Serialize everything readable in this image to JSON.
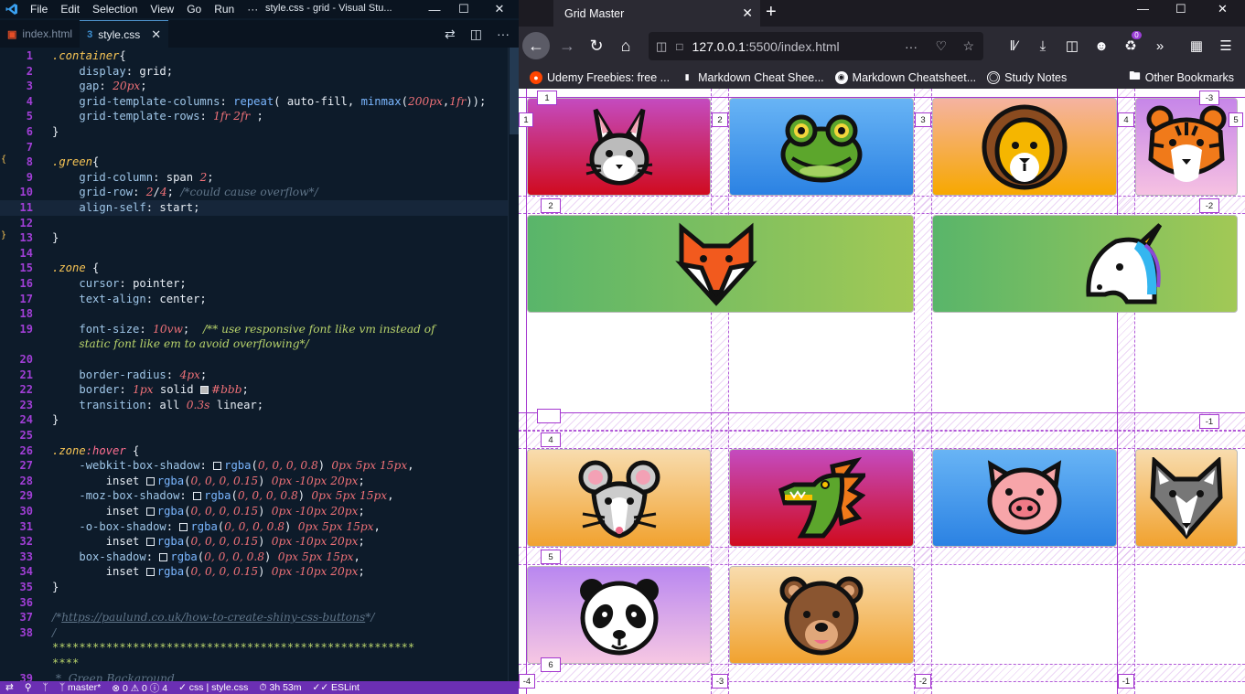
{
  "vscode": {
    "menus": [
      "File",
      "Edit",
      "Selection",
      "View",
      "Go",
      "Run",
      "···"
    ],
    "title": "style.css - grid - Visual Stu...",
    "tabs": [
      {
        "label": "index.html",
        "icon": "html-file-icon",
        "active": false
      },
      {
        "label": "style.css",
        "icon": "css-file-icon",
        "active": true
      }
    ],
    "status": {
      "branch": "master*",
      "errors": "0",
      "warnings": "0",
      "infos": "4",
      "language": "css | style.css",
      "time": "3h 53m",
      "linter": "ESLint"
    }
  },
  "code": [
    {
      "n": "1",
      "html": "<span class='t-sel'>.container</span><span class='t-plain'>{</span>"
    },
    {
      "n": "2",
      "html": "    <span class='t-prop'>display</span><span class='t-plain'>: grid;</span>"
    },
    {
      "n": "3",
      "html": "    <span class='t-prop'>gap</span><span class='t-plain'>: </span><span class='t-num'>20px</span><span class='t-plain'>;</span>"
    },
    {
      "n": "4",
      "html": "    <span class='t-prop'>grid-template-columns</span><span class='t-plain'>: </span><span class='t-fn'>repeat</span><span class='t-plain'>( auto-fill, </span><span class='t-fn'>minmax</span><span class='t-plain'>(</span><span class='t-num'>200px</span><span class='t-plain'>,</span><span class='t-num'>1fr</span><span class='t-plain'>));</span>"
    },
    {
      "n": "5",
      "html": "    <span class='t-prop'>grid-template-rows</span><span class='t-plain'>: </span><span class='t-num'>1fr 2fr</span><span class='t-plain'> ;</span>"
    },
    {
      "n": "6",
      "html": "<span class='t-plain'>}</span>"
    },
    {
      "n": "7",
      "html": ""
    },
    {
      "n": "8",
      "html": "<span class='t-sel'>.green</span><span class='t-plain'>{</span>"
    },
    {
      "n": "9",
      "html": "    <span class='t-prop'>grid-column</span><span class='t-plain'>: span </span><span class='t-num'>2</span><span class='t-plain'>;</span>"
    },
    {
      "n": "10",
      "html": "    <span class='t-prop'>grid-row</span><span class='t-plain'>: </span><span class='t-num'>2</span><span class='t-plain'>/</span><span class='t-num'>4</span><span class='t-plain'>; </span><span class='t-comment'>/*could cause overflow*/</span>"
    },
    {
      "n": "11",
      "html": "    <span class='t-prop'>align-self</span><span class='t-plain'>: start;</span>",
      "hl": true
    },
    {
      "n": "12",
      "html": ""
    },
    {
      "n": "13",
      "html": "<span class='t-plain'>}</span>"
    },
    {
      "n": "14",
      "html": ""
    },
    {
      "n": "15",
      "html": "<span class='t-sel'>.zone</span><span class='t-plain'> {</span>"
    },
    {
      "n": "16",
      "html": "    <span class='t-prop'>cursor</span><span class='t-plain'>: pointer;</span>"
    },
    {
      "n": "17",
      "html": "    <span class='t-prop'>text-align</span><span class='t-plain'>: center;</span>"
    },
    {
      "n": "18",
      "html": ""
    },
    {
      "n": "19",
      "html": "    <span class='t-prop'>font-size</span><span class='t-plain'>: </span><span class='t-num'>10vw</span><span class='t-plain'>;  </span><span class='t-comment2'>/** use responsive font like vm instead of</span>"
    },
    {
      "n": "",
      "html": "    <span class='t-comment2'>static font like em to avoid overflowing*/</span>"
    },
    {
      "n": "20",
      "html": ""
    },
    {
      "n": "21",
      "html": "    <span class='t-prop'>border-radius</span><span class='t-plain'>: </span><span class='t-num'>4px</span><span class='t-plain'>;</span>"
    },
    {
      "n": "22",
      "html": "    <span class='t-prop'>border</span><span class='t-plain'>: </span><span class='t-num'>1px</span><span class='t-plain'> solid </span><span class='swatch grey'></span><span class='t-num'>#bbb</span><span class='t-plain'>;</span>"
    },
    {
      "n": "23",
      "html": "    <span class='t-prop'>transition</span><span class='t-plain'>: all </span><span class='t-num'>0.3s</span><span class='t-plain'> linear;</span>"
    },
    {
      "n": "24",
      "html": "<span class='t-plain'>}</span>"
    },
    {
      "n": "25",
      "html": ""
    },
    {
      "n": "26",
      "html": "<span class='t-sel'>.zone</span><span class='t-pseudo'>:hover</span><span class='t-plain'> {</span>"
    },
    {
      "n": "27",
      "html": "    <span class='t-prop'>-webkit-box-shadow</span><span class='t-plain'>: </span><span class='swatch'></span><span class='t-fn'>rgba</span><span class='t-plain'>(</span><span class='t-num'>0, 0, 0, 0.8</span><span class='t-plain'>) </span><span class='t-num'>0px 5px 15px</span><span class='t-plain'>,</span>"
    },
    {
      "n": "28",
      "html": "        <span class='t-plain'>inset </span><span class='swatch'></span><span class='t-fn'>rgba</span><span class='t-plain'>(</span><span class='t-num'>0, 0, 0, 0.15</span><span class='t-plain'>) </span><span class='t-num'>0px -10px 20px</span><span class='t-plain'>;</span>"
    },
    {
      "n": "29",
      "html": "    <span class='t-prop'>-moz-box-shadow</span><span class='t-plain'>: </span><span class='swatch'></span><span class='t-fn'>rgba</span><span class='t-plain'>(</span><span class='t-num'>0, 0, 0, 0.8</span><span class='t-plain'>) </span><span class='t-num'>0px 5px 15px</span><span class='t-plain'>,</span>"
    },
    {
      "n": "30",
      "html": "        <span class='t-plain'>inset </span><span class='swatch'></span><span class='t-fn'>rgba</span><span class='t-plain'>(</span><span class='t-num'>0, 0, 0, 0.15</span><span class='t-plain'>) </span><span class='t-num'>0px -10px 20px</span><span class='t-plain'>;</span>"
    },
    {
      "n": "31",
      "html": "    <span class='t-prop'>-o-box-shadow</span><span class='t-plain'>: </span><span class='swatch'></span><span class='t-fn'>rgba</span><span class='t-plain'>(</span><span class='t-num'>0, 0, 0, 0.8</span><span class='t-plain'>) </span><span class='t-num'>0px 5px 15px</span><span class='t-plain'>,</span>"
    },
    {
      "n": "32",
      "html": "        <span class='t-plain'>inset </span><span class='swatch'></span><span class='t-fn'>rgba</span><span class='t-plain'>(</span><span class='t-num'>0, 0, 0, 0.15</span><span class='t-plain'>) </span><span class='t-num'>0px -10px 20px</span><span class='t-plain'>;</span>"
    },
    {
      "n": "33",
      "html": "    <span class='t-prop'>box-shadow</span><span class='t-plain'>: </span><span class='swatch'></span><span class='t-fn'>rgba</span><span class='t-plain'>(</span><span class='t-num'>0, 0, 0, 0.8</span><span class='t-plain'>) </span><span class='t-num'>0px 5px 15px</span><span class='t-plain'>,</span>"
    },
    {
      "n": "34",
      "html": "        <span class='t-plain'>inset </span><span class='swatch'></span><span class='t-fn'>rgba</span><span class='t-plain'>(</span><span class='t-num'>0, 0, 0, 0.15</span><span class='t-plain'>) </span><span class='t-num'>0px -10px 20px</span><span class='t-plain'>;</span>"
    },
    {
      "n": "35",
      "html": "<span class='t-plain'>}</span>"
    },
    {
      "n": "36",
      "html": ""
    },
    {
      "n": "37",
      "html": "<span class='t-comment'>/*</span><span class='t-link'>https://paulund.co.uk/how-to-create-shiny-css-buttons</span><span class='t-comment'>*/</span>"
    },
    {
      "n": "38",
      "html": "<span class='t-comment'>/</span>"
    },
    {
      "n": "",
      "html": "<span class='t-stars'>******************************************************</span>"
    },
    {
      "n": "",
      "html": "<span class='t-stars'>****</span>"
    },
    {
      "n": "39",
      "html": "<span class='t-comment'> *  Green Backaround</span>"
    }
  ],
  "firefox": {
    "tab_title": "Grid Master",
    "url_host": "127.0.0.1",
    "url_rest": ":5500/index.html",
    "bookmarks": [
      {
        "label": "Udemy Freebies: free ...",
        "icon": "reddit-icon"
      },
      {
        "label": "Markdown Cheat Shee...",
        "icon": "page-icon"
      },
      {
        "label": "Markdown Cheatsheet...",
        "icon": "github-icon"
      },
      {
        "label": "Study Notes",
        "icon": "globe-icon"
      }
    ],
    "other_bookmarks": "Other Bookmarks",
    "extension_badge": "0"
  },
  "grid": {
    "zones": [
      {
        "animal": "rabbit",
        "gradient": "g-pink-red"
      },
      {
        "animal": "frog",
        "gradient": "g-blue"
      },
      {
        "animal": "lion",
        "gradient": "g-peach-orange"
      },
      {
        "animal": "tiger",
        "gradient": "g-purple-pink"
      },
      {
        "animal": "fox",
        "gradient": "g-green"
      },
      {
        "animal": "unicorn",
        "gradient": "g-green"
      },
      {
        "animal": "mouse",
        "gradient": "g-cream-orange"
      },
      {
        "animal": "dragon",
        "gradient": "g-pink-red"
      },
      {
        "animal": "pig",
        "gradient": "g-blue"
      },
      {
        "animal": "wolf",
        "gradient": "g-cream-orange"
      },
      {
        "animal": "panda",
        "gradient": "g-purple-lt"
      },
      {
        "animal": "bear",
        "gradient": "g-cream-orange"
      }
    ],
    "row_badges_left": [
      "1",
      "2",
      "4",
      "5",
      "6"
    ],
    "row_badges_right": [
      "-3",
      "-2",
      "-1"
    ],
    "col_badges_top": [
      "1",
      "2",
      "3",
      "4",
      "5"
    ],
    "col_badges_bottom": [
      "-4",
      "-3",
      "-2",
      "-1"
    ]
  }
}
